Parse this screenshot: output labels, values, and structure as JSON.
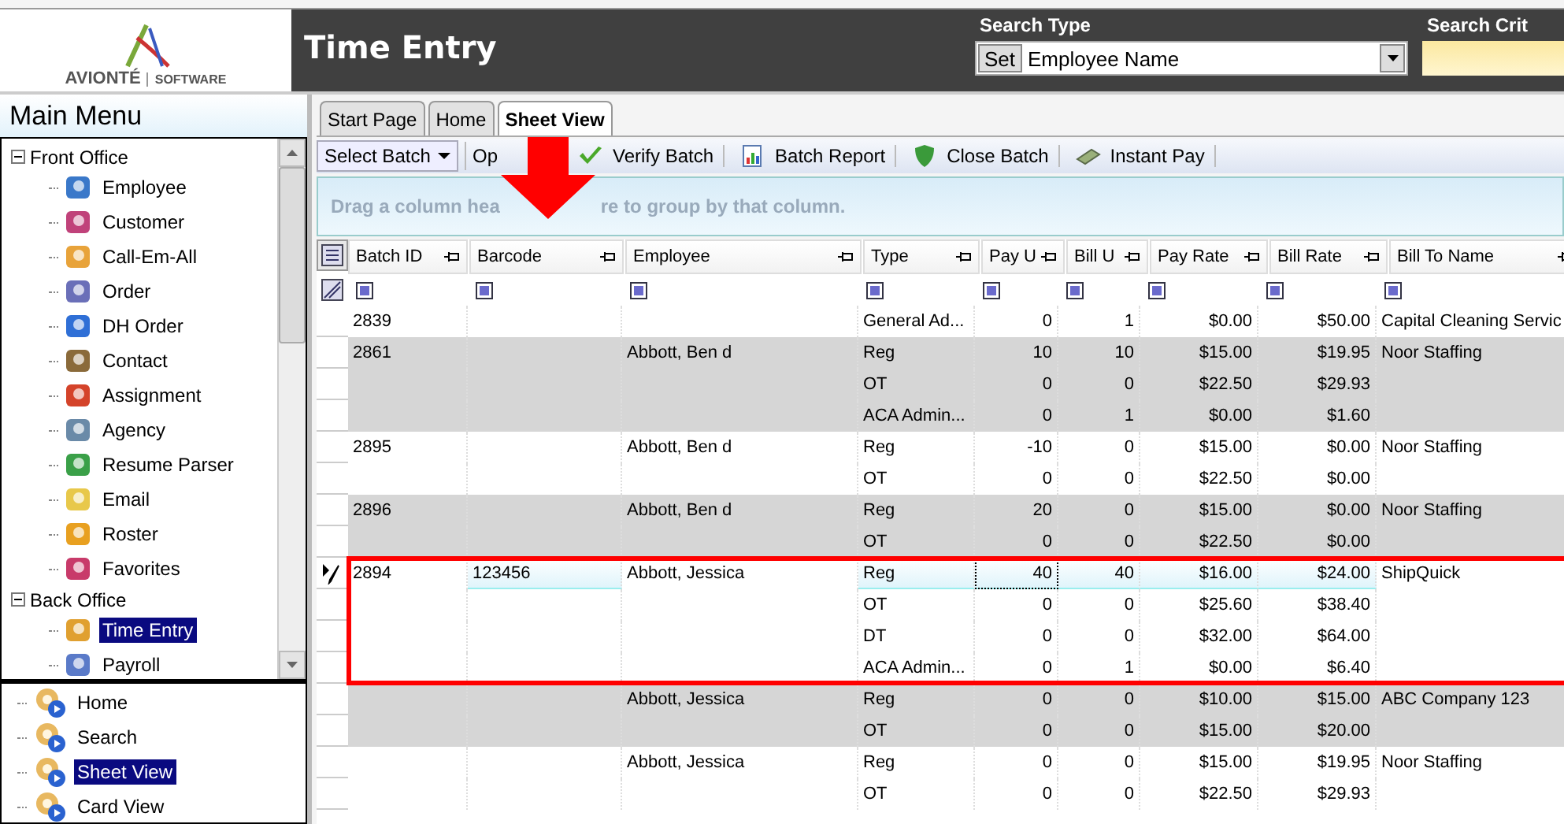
{
  "header": {
    "logo_name": "AVIONTÉ",
    "logo_tag": "SOFTWARE",
    "title": "Time Entry",
    "search_type_label": "Search Type",
    "set_button": "Set",
    "search_type_value": "Employee Name",
    "search_criteria_label": "Search Crit"
  },
  "sidebar": {
    "title": "Main Menu",
    "tree": [
      {
        "label": "Front Office",
        "expanded": true,
        "children": [
          {
            "label": "Employee",
            "selected": false
          },
          {
            "label": "Customer",
            "selected": false
          },
          {
            "label": "Call-Em-All",
            "selected": false
          },
          {
            "label": "Order",
            "selected": false
          },
          {
            "label": "DH Order",
            "selected": false
          },
          {
            "label": "Contact",
            "selected": false
          },
          {
            "label": "Assignment",
            "selected": false
          },
          {
            "label": "Agency",
            "selected": false
          },
          {
            "label": "Resume Parser",
            "selected": false
          },
          {
            "label": "Email",
            "selected": false
          },
          {
            "label": "Roster",
            "selected": false
          },
          {
            "label": "Favorites",
            "selected": false
          }
        ]
      },
      {
        "label": "Back Office",
        "expanded": true,
        "children": [
          {
            "label": "Time Entry",
            "selected": true
          },
          {
            "label": "Payroll",
            "selected": false
          }
        ]
      }
    ],
    "sub_items": [
      {
        "label": "Home",
        "selected": false
      },
      {
        "label": "Search",
        "selected": false
      },
      {
        "label": "Sheet View",
        "selected": true
      },
      {
        "label": "Card View",
        "selected": false
      }
    ]
  },
  "tabs": [
    {
      "label": "Start Page",
      "selected": false
    },
    {
      "label": "Home",
      "selected": false
    },
    {
      "label": "Sheet View",
      "selected": true
    }
  ],
  "toolbar": {
    "select_batch": "Select Batch",
    "options": "Op",
    "buttons": [
      {
        "label": "Verify Batch",
        "kind": "check"
      },
      {
        "label": "Batch Report",
        "kind": "report"
      },
      {
        "label": "Close Batch",
        "kind": "shield"
      },
      {
        "label": "Instant Pay",
        "kind": "money"
      }
    ]
  },
  "group_panel": [
    "Drag a column hea",
    "re to group by that column."
  ],
  "table": {
    "columns": [
      "Batch ID",
      "Barcode",
      "Employee",
      "Type",
      "Pay U",
      "Bill U",
      "Pay Rate",
      "Bill Rate",
      "Bill To Name"
    ],
    "groups": [
      {
        "batch_id": "2839",
        "bill_to": "Capital Cleaning Servic",
        "current": false,
        "highlighted": false,
        "lines": [
          {
            "type": "General Ad...",
            "pay_u": "0",
            "bill_u": "1",
            "pay_rate": "$0.00",
            "bill_rate": "$50.00"
          }
        ]
      },
      {
        "batch_id": "2861",
        "employee": "Abbott, Ben d",
        "bill_to": "Noor Staffing",
        "current": false,
        "highlighted": false,
        "lines": [
          {
            "type": "Reg",
            "pay_u": "10",
            "bill_u": "10",
            "pay_rate": "$15.00",
            "bill_rate": "$19.95"
          },
          {
            "type": "OT",
            "pay_u": "0",
            "bill_u": "0",
            "pay_rate": "$22.50",
            "bill_rate": "$29.93"
          },
          {
            "type": "ACA Admin...",
            "pay_u": "0",
            "bill_u": "1",
            "pay_rate": "$0.00",
            "bill_rate": "$1.60"
          }
        ]
      },
      {
        "batch_id": "2895",
        "employee": "Abbott, Ben d",
        "bill_to": "Noor Staffing",
        "current": false,
        "highlighted": false,
        "lines": [
          {
            "type": "Reg",
            "pay_u": "-10",
            "bill_u": "0",
            "pay_rate": "$15.00",
            "bill_rate": "$0.00"
          },
          {
            "type": "OT",
            "pay_u": "0",
            "bill_u": "0",
            "pay_rate": "$22.50",
            "bill_rate": "$0.00"
          }
        ]
      },
      {
        "batch_id": "2896",
        "employee": "Abbott, Ben d",
        "bill_to": "Noor Staffing",
        "current": false,
        "highlighted": false,
        "lines": [
          {
            "type": "Reg",
            "pay_u": "20",
            "bill_u": "0",
            "pay_rate": "$15.00",
            "bill_rate": "$0.00"
          },
          {
            "type": "OT",
            "pay_u": "0",
            "bill_u": "0",
            "pay_rate": "$22.50",
            "bill_rate": "$0.00"
          }
        ]
      },
      {
        "batch_id": "2894",
        "barcode": "123456",
        "employee": "Abbott, Jessica",
        "bill_to": "ShipQuick",
        "current": true,
        "highlighted": true,
        "lines": [
          {
            "type": "Reg",
            "pay_u": "40",
            "bill_u": "40",
            "pay_rate": "$16.00",
            "bill_rate": "$24.00"
          },
          {
            "type": "OT",
            "pay_u": "0",
            "bill_u": "0",
            "pay_rate": "$25.60",
            "bill_rate": "$38.40"
          },
          {
            "type": "DT",
            "pay_u": "0",
            "bill_u": "0",
            "pay_rate": "$32.00",
            "bill_rate": "$64.00"
          },
          {
            "type": "ACA Admin...",
            "pay_u": "0",
            "bill_u": "1",
            "pay_rate": "$0.00",
            "bill_rate": "$6.40"
          }
        ]
      },
      {
        "employee": "Abbott, Jessica",
        "bill_to": "ABC Company 123",
        "current": false,
        "highlighted": false,
        "lines": [
          {
            "type": "Reg",
            "pay_u": "0",
            "bill_u": "0",
            "pay_rate": "$10.00",
            "bill_rate": "$15.00"
          },
          {
            "type": "OT",
            "pay_u": "0",
            "bill_u": "0",
            "pay_rate": "$15.00",
            "bill_rate": "$20.00"
          }
        ]
      },
      {
        "employee": "Abbott, Jessica",
        "bill_to": "Noor Staffing",
        "current": false,
        "highlighted": false,
        "lines": [
          {
            "type": "Reg",
            "pay_u": "0",
            "bill_u": "0",
            "pay_rate": "$15.00",
            "bill_rate": "$19.95"
          },
          {
            "type": "OT",
            "pay_u": "0",
            "bill_u": "0",
            "pay_rate": "$22.50",
            "bill_rate": "$29.93"
          }
        ]
      }
    ]
  }
}
